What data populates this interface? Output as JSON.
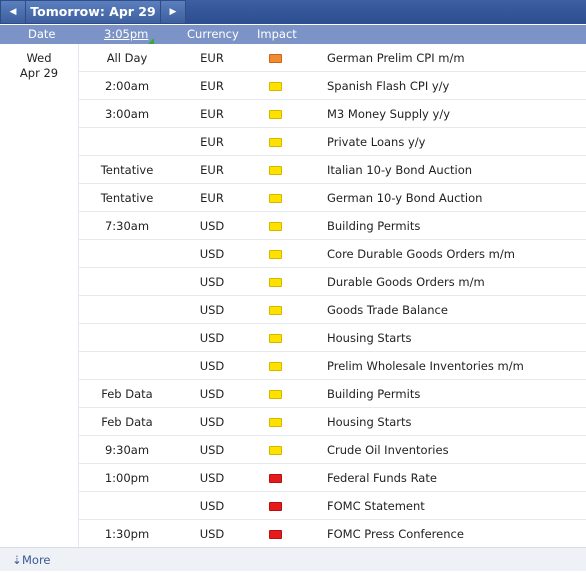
{
  "nav": {
    "prev_icon": "◀",
    "title": "Tomorrow: Apr 29",
    "next_icon": "▶"
  },
  "header": {
    "date": "Date",
    "time": "3:05pm",
    "currency": "Currency",
    "impact": "Impact"
  },
  "day": {
    "weekday": "Wed",
    "date": "Apr 29"
  },
  "impact_colors": {
    "yellow": "#ffe100",
    "orange": "#f28b30",
    "red": "#e51b1b"
  },
  "rows": [
    {
      "time": "All Day",
      "currency": "EUR",
      "impact": "orange",
      "event": "German Prelim CPI m/m"
    },
    {
      "time": "2:00am",
      "currency": "EUR",
      "impact": "yellow",
      "event": "Spanish Flash CPI y/y"
    },
    {
      "time": "3:00am",
      "currency": "EUR",
      "impact": "yellow",
      "event": "M3 Money Supply y/y"
    },
    {
      "time": "",
      "currency": "EUR",
      "impact": "yellow",
      "event": "Private Loans y/y"
    },
    {
      "time": "Tentative",
      "currency": "EUR",
      "impact": "yellow",
      "event": "Italian 10-y Bond Auction"
    },
    {
      "time": "Tentative",
      "currency": "EUR",
      "impact": "yellow",
      "event": "German 10-y Bond Auction"
    },
    {
      "time": "7:30am",
      "currency": "USD",
      "impact": "yellow",
      "event": "Building Permits"
    },
    {
      "time": "",
      "currency": "USD",
      "impact": "yellow",
      "event": "Core Durable Goods Orders m/m"
    },
    {
      "time": "",
      "currency": "USD",
      "impact": "yellow",
      "event": "Durable Goods Orders m/m"
    },
    {
      "time": "",
      "currency": "USD",
      "impact": "yellow",
      "event": "Goods Trade Balance"
    },
    {
      "time": "",
      "currency": "USD",
      "impact": "yellow",
      "event": "Housing Starts"
    },
    {
      "time": "",
      "currency": "USD",
      "impact": "yellow",
      "event": "Prelim Wholesale Inventories m/m"
    },
    {
      "time": "Feb Data",
      "currency": "USD",
      "impact": "yellow",
      "event": "Building Permits"
    },
    {
      "time": "Feb Data",
      "currency": "USD",
      "impact": "yellow",
      "event": "Housing Starts"
    },
    {
      "time": "9:30am",
      "currency": "USD",
      "impact": "yellow",
      "event": "Crude Oil Inventories"
    },
    {
      "time": "1:00pm",
      "currency": "USD",
      "impact": "red",
      "event": "Federal Funds Rate"
    },
    {
      "time": "",
      "currency": "USD",
      "impact": "red",
      "event": "FOMC Statement"
    },
    {
      "time": "1:30pm",
      "currency": "USD",
      "impact": "red",
      "event": "FOMC Press Conference"
    }
  ],
  "footer": {
    "more_icon": "⇣",
    "more_label": "More"
  }
}
